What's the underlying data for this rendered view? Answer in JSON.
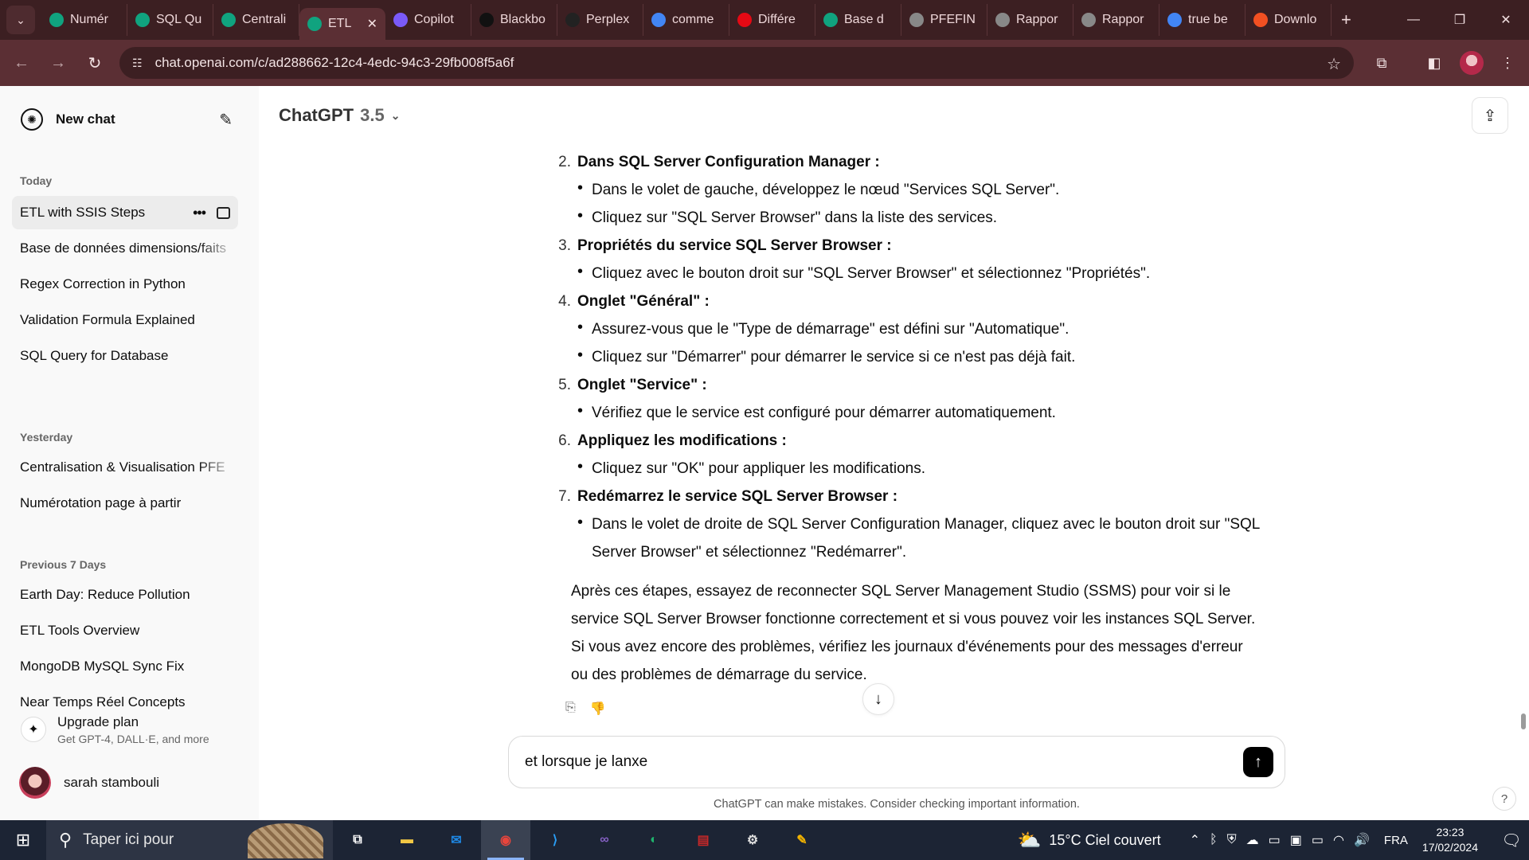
{
  "browser": {
    "tabs": [
      {
        "label": "Numér",
        "icon": "chatgpt-icon",
        "color": "#10a37f"
      },
      {
        "label": "SQL Qu",
        "icon": "chatgpt-icon",
        "color": "#10a37f"
      },
      {
        "label": "Centrali",
        "icon": "chatgpt-icon",
        "color": "#10a37f"
      },
      {
        "label": "ETL",
        "icon": "chatgpt-icon",
        "color": "#10a37f",
        "active": true
      },
      {
        "label": "Copilot",
        "icon": "copilot-icon",
        "color": "#7a5af8"
      },
      {
        "label": "Blackbo",
        "icon": "blackbox-icon",
        "color": "#111111"
      },
      {
        "label": "Perplex",
        "icon": "perplexity-icon",
        "color": "#222222"
      },
      {
        "label": "comme",
        "icon": "google-icon",
        "color": "#4285f4"
      },
      {
        "label": "Différe",
        "icon": "netflix-icon",
        "color": "#e50914"
      },
      {
        "label": "Base d",
        "icon": "chatgpt-icon",
        "color": "#10a37f"
      },
      {
        "label": "PFEFIN",
        "icon": "globe-icon",
        "color": "#888888"
      },
      {
        "label": "Rappor",
        "icon": "globe-icon",
        "color": "#888888"
      },
      {
        "label": "Rappor",
        "icon": "globe-icon",
        "color": "#888888"
      },
      {
        "label": "true be",
        "icon": "google-icon",
        "color": "#4285f4"
      },
      {
        "label": "Downlo",
        "icon": "microsoft-icon",
        "color": "#f25022"
      }
    ],
    "url": "chat.openai.com/c/ad288662-12c4-4edc-94c3-29fb008f5a6f"
  },
  "sidebar": {
    "new_chat": "New chat",
    "sections": [
      {
        "label": "Today",
        "items": [
          "ETL with SSIS Steps",
          "Base de données dimensions/faits",
          "Regex Correction in Python",
          "Validation Formula Explained",
          "SQL Query for Database"
        ]
      },
      {
        "label": "Yesterday",
        "items": [
          "Centralisation & Visualisation PFE",
          "Numérotation page à partir"
        ]
      },
      {
        "label": "Previous 7 Days",
        "items": [
          "Earth Day: Reduce Pollution",
          "ETL Tools Overview",
          "MongoDB MySQL Sync Fix",
          "Near Temps Réel Concepts"
        ]
      }
    ],
    "upgrade_title": "Upgrade plan",
    "upgrade_sub": "Get GPT-4, DALL·E, and more",
    "user_name": "sarah stambouli"
  },
  "main": {
    "model": "ChatGPT",
    "model_version": "3.5",
    "steps": [
      {
        "num": "2.",
        "title": "Dans SQL Server Configuration Manager :",
        "bullets": [
          "Dans le volet de gauche, développez le nœud \"Services SQL Server\".",
          "Cliquez sur \"SQL Server Browser\" dans la liste des services."
        ]
      },
      {
        "num": "3.",
        "title": "Propriétés du service SQL Server Browser :",
        "bullets": [
          "Cliquez avec le bouton droit sur \"SQL Server Browser\" et sélectionnez \"Propriétés\"."
        ]
      },
      {
        "num": "4.",
        "title": "Onglet \"Général\" :",
        "bullets": [
          "Assurez-vous que le \"Type de démarrage\" est défini sur \"Automatique\".",
          "Cliquez sur \"Démarrer\" pour démarrer le service si ce n'est pas déjà fait."
        ]
      },
      {
        "num": "5.",
        "title": "Onglet \"Service\" :",
        "bullets": [
          "Vérifiez que le service est configuré pour démarrer automatiquement."
        ]
      },
      {
        "num": "6.",
        "title": "Appliquez les modifications :",
        "bullets": [
          "Cliquez sur \"OK\" pour appliquer les modifications."
        ]
      },
      {
        "num": "7.",
        "title": "Redémarrez le service SQL Server Browser :",
        "bullets": [
          "Dans le volet de droite de SQL Server Configuration Manager, cliquez avec le bouton droit sur \"SQL Server Browser\" et sélectionnez \"Redémarrer\"."
        ]
      }
    ],
    "closing": "Après ces étapes, essayez de reconnecter SQL Server Management Studio (SSMS) pour voir si le service SQL Server Browser fonctionne correctement et si vous pouvez voir les instances SQL Server. Si vous avez encore des problèmes, vérifiez les journaux d'événements pour des messages d'erreur ou des problèmes de démarrage du service.",
    "composer_text": "et lorsque je lanxe",
    "disclaimer": "ChatGPT can make mistakes. Consider checking important information.",
    "help": "?"
  },
  "taskbar": {
    "search_placeholder": "Taper ici pour",
    "apps": [
      {
        "name": "task-view-icon",
        "glyph": "⧉",
        "color": "#ffffff"
      },
      {
        "name": "file-explorer-icon",
        "glyph": "▬",
        "color": "#f2c744"
      },
      {
        "name": "mail-icon",
        "glyph": "✉",
        "color": "#1e88e5"
      },
      {
        "name": "chrome-icon",
        "glyph": "◉",
        "color": "#e8453c",
        "active": true
      },
      {
        "name": "vscode-icon",
        "glyph": "⟩",
        "color": "#2a9df4"
      },
      {
        "name": "visual-studio-icon",
        "glyph": "∞",
        "color": "#8661c5"
      },
      {
        "name": "edge-icon",
        "glyph": "◐",
        "color": "#1fb36d"
      },
      {
        "name": "ssms-icon",
        "glyph": "▤",
        "color": "#c62828"
      },
      {
        "name": "settings-icon",
        "glyph": "⚙",
        "color": "#dddddd"
      },
      {
        "name": "tools-icon",
        "glyph": "✎",
        "color": "#f4b400"
      }
    ],
    "weather": "15°C  Ciel couvert",
    "lang": "FRA",
    "time": "23:23",
    "date": "17/02/2024"
  }
}
